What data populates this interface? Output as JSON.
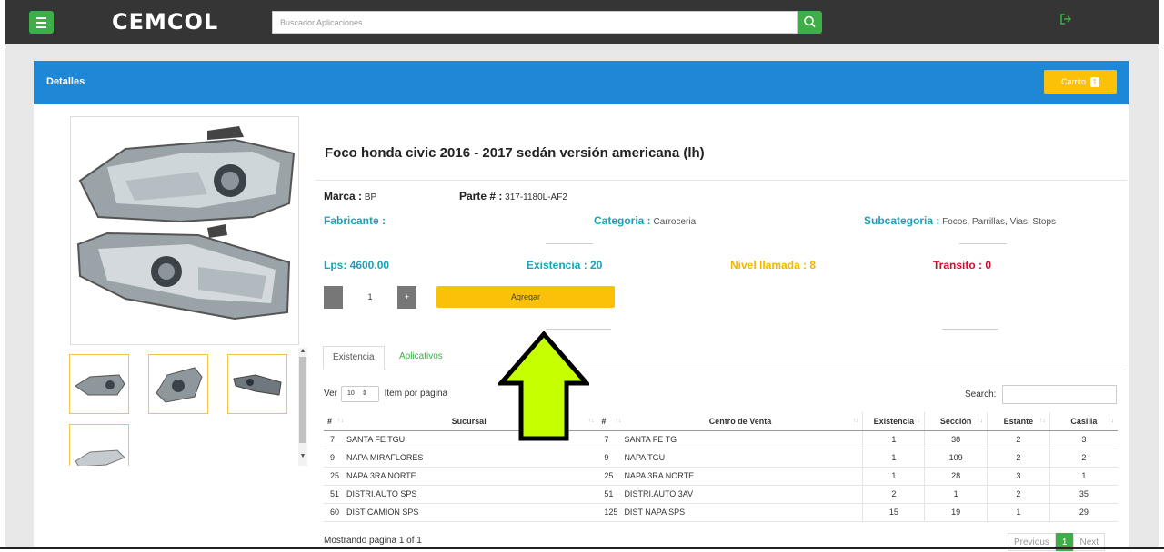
{
  "app": {
    "logo": "CEMCOL",
    "search_placeholder": "Buscador Aplicaciones"
  },
  "card": {
    "title": "Detalles",
    "cart_label": "Carrito",
    "cart_count": "1"
  },
  "product": {
    "title": "Foco honda civic 2016 - 2017 sedán versión americana (lh)",
    "marca_label": "Marca :",
    "marca_value": "BP",
    "parte_label": "Parte # :",
    "parte_value": "317-1180L-AF2",
    "fabricante_label": "Fabricante :",
    "fabricante_value": "",
    "categoria_label": "Categoria :",
    "categoria_value": "Carroceria",
    "subcategoria_label": "Subcategoria :",
    "subcategoria_value": "Focos, Parrillas, Vias, Stops",
    "price": "Lps: 4600.00",
    "existencia": "Existencia : 20",
    "nivel": "Nivel llamada : 8",
    "transito": "Transito : 0",
    "qty": "1",
    "qty_minus": "-",
    "qty_plus": "+",
    "add_label": "Agregar"
  },
  "tabs": [
    "Existencia",
    "Aplicativos"
  ],
  "table_controls": {
    "ver_label": "Ver",
    "page_size": "10",
    "item_label": "Item por pagina",
    "search_label": "Search:"
  },
  "table": {
    "headers": [
      "#",
      "Sucursal",
      "#",
      "Centro de Venta",
      "Existencia",
      "Sección",
      "Estante",
      "Casilla"
    ],
    "rows": [
      [
        "7",
        "SANTA FE TGU",
        "7",
        "SANTA FE TG",
        "1",
        "38",
        "2",
        "3"
      ],
      [
        "9",
        "NAPA MIRAFLORES",
        "9",
        "NAPA TGU",
        "1",
        "109",
        "2",
        "2"
      ],
      [
        "25",
        "NAPA 3RA NORTE",
        "25",
        "NAPA 3RA NORTE",
        "1",
        "28",
        "3",
        "1"
      ],
      [
        "51",
        "DISTRI.AUTO SPS",
        "51",
        "DISTRI.AUTO 3AV",
        "2",
        "1",
        "2",
        "35"
      ],
      [
        "60",
        "DIST CAMION SPS",
        "125",
        "DIST NAPA SPS",
        "15",
        "19",
        "1",
        "29"
      ]
    ]
  },
  "footer": {
    "info": "Mostrando pagina 1 of 1",
    "prev": "Previous",
    "page": "1",
    "next": "Next"
  },
  "colors": {
    "green": "#3fae49",
    "blue_header": "#1e88d6",
    "yellow": "#fbc108",
    "teal": "#1aa3b8",
    "red": "#c8102e",
    "orange": "#f7b500"
  }
}
